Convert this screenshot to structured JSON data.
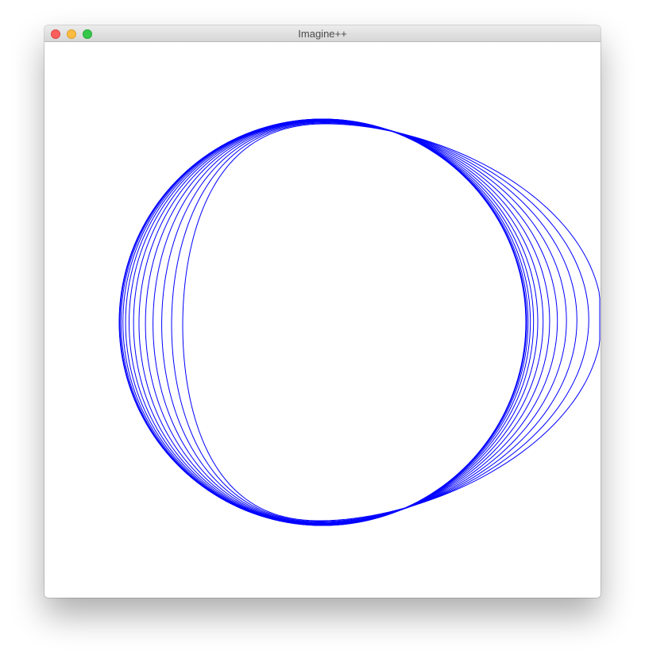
{
  "window": {
    "title": "Imagine++",
    "controls": {
      "close": "close-icon",
      "minimize": "minimize-icon",
      "zoom": "zoom-icon"
    }
  },
  "drawing": {
    "stroke_color": "#0000ff",
    "background": "#ffffff",
    "curve_count": 14
  }
}
